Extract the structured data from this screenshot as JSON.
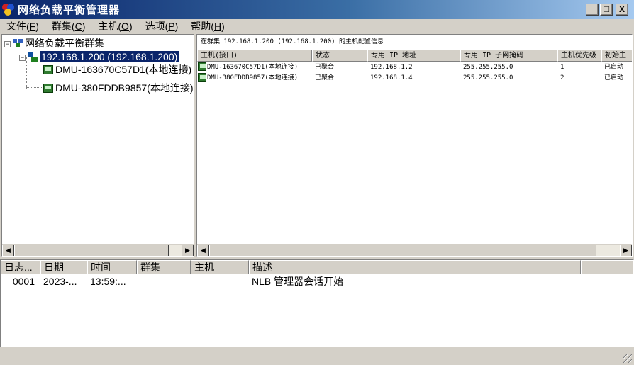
{
  "window": {
    "title": "网络负载平衡管理器",
    "controls": {
      "minimize": "_",
      "maximize": "□",
      "close": "X"
    }
  },
  "menu": [
    {
      "label": "文件",
      "key": "F"
    },
    {
      "label": "群集",
      "key": "C"
    },
    {
      "label": "主机",
      "key": "O"
    },
    {
      "label": "选项",
      "key": "P"
    },
    {
      "label": "帮助",
      "key": "H"
    }
  ],
  "tree": {
    "root_label": "网络负载平衡群集",
    "cluster_label": "192.168.1.200 (192.168.1.200)",
    "hosts": [
      "DMU-163670C57D1(本地连接)",
      "DMU-380FDDB9857(本地连接)"
    ]
  },
  "detail": {
    "caption": "在群集 192.168.1.200 (192.168.1.200) 的主机配置信息",
    "columns": [
      "主机(接口)",
      "状态",
      "专用 IP 地址",
      "专用 IP 子网掩码",
      "主机优先级",
      "初始主"
    ],
    "rows": [
      [
        "DMU-163670C57D1(本地连接)",
        "已聚合",
        "192.168.1.2",
        "255.255.255.0",
        "1",
        "已启动"
      ],
      [
        "DMU-380FDDB9857(本地连接)",
        "已聚合",
        "192.168.1.4",
        "255.255.255.0",
        "2",
        "已启动"
      ]
    ]
  },
  "log": {
    "columns": [
      "日志...",
      "日期",
      "时间",
      "群集",
      "主机",
      "描述"
    ],
    "rows": [
      [
        "0001",
        "2023-...",
        "13:59:...",
        "",
        "",
        "NLB 管理器会话开始"
      ]
    ]
  },
  "scroll_glyphs": {
    "left": "◀",
    "right": "▶"
  },
  "colors": {
    "title_start": "#0a246a",
    "title_end": "#a6caf0",
    "selection": "#0a246a",
    "face": "#d4d0c8"
  }
}
